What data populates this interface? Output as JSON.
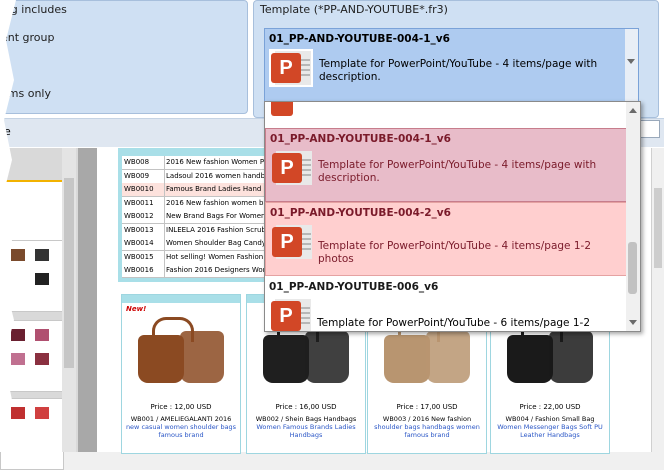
{
  "catalog_group": {
    "title": "log includes",
    "options": [
      "ent group",
      "e",
      "ems only"
    ]
  },
  "bottom_bar_label": "e",
  "template_group": {
    "title": "Template (*PP-AND-YOUTUBE*.fr3)",
    "selected": {
      "name": "01_PP-AND-YOUTUBE-004-1_v6",
      "desc1": "Template for PowerPoint/YouTube - 4 items/page  with",
      "desc2": "description."
    }
  },
  "dropdown": {
    "items": [
      {
        "name": "01_PP-AND-YOUTUBE-004-1_v6",
        "desc1": "Template for PowerPoint/YouTube - 4 items/page  with",
        "desc2": "description.",
        "state": "hot"
      },
      {
        "name": "01_PP-AND-YOUTUBE-004-2_v6",
        "desc1": "Template for PowerPoint/YouTube - 4 items/page 1-2 photos",
        "desc2": "",
        "state": "selected"
      },
      {
        "name": "01_PP-AND-YOUTUBE-006_v6",
        "desc1": "Template for PowerPoint/YouTube - 6 items/page 1-2 photos",
        "desc2": "",
        "state": "normal"
      }
    ]
  },
  "icon_letter": "P",
  "price_list": [
    {
      "code": "WB008",
      "desc": "2016 New fashion Women Pu"
    },
    {
      "code": "WB009",
      "desc": "Ladsoul 2016 women handbag"
    },
    {
      "code": "WB0010",
      "desc": "Famous Brand Ladies Hand B"
    },
    {
      "code": "WB0011",
      "desc": "2016 New fashion women bag"
    },
    {
      "code": "WB0012",
      "desc": "New Brand Bags For Women"
    },
    {
      "code": "WB0013",
      "desc": "INLEELA 2016 Fashion Scrub"
    },
    {
      "code": "WB0014",
      "desc": "Women Shoulder Bag Candy 1"
    },
    {
      "code": "WB0015",
      "desc": "Hot selling! Women Fashion S"
    },
    {
      "code": "WB0016",
      "desc": "Fashion 2016 Designers Wom"
    }
  ],
  "products": [
    {
      "badge": "New!",
      "price": "Price  :  12,00 USD",
      "title": "WB001  /  AMELIEGALANTI 2016",
      "desc": "new casual women shoulder bags famous brand",
      "color": "#8b4a22"
    },
    {
      "badge": "",
      "price": "Price  :  16,00 USD",
      "title": "WB002  /  Shein Bags Handbags",
      "desc": "Women Famous Brands Ladies Handbags",
      "color": "#1f1f1f"
    },
    {
      "badge": "",
      "price": "Price  :  17,00 USD",
      "title": "WB003  /  2016 New fashion",
      "desc": "shoulder bags handbags women famous brand",
      "color": "#b89570"
    },
    {
      "badge": "",
      "price": "Price  :  22,00 USD",
      "title": "WB004  /  Fashion Small Bag",
      "desc": "Women Messenger Bags Soft PU Leather Handbags",
      "color": "#1a1a1a"
    }
  ]
}
